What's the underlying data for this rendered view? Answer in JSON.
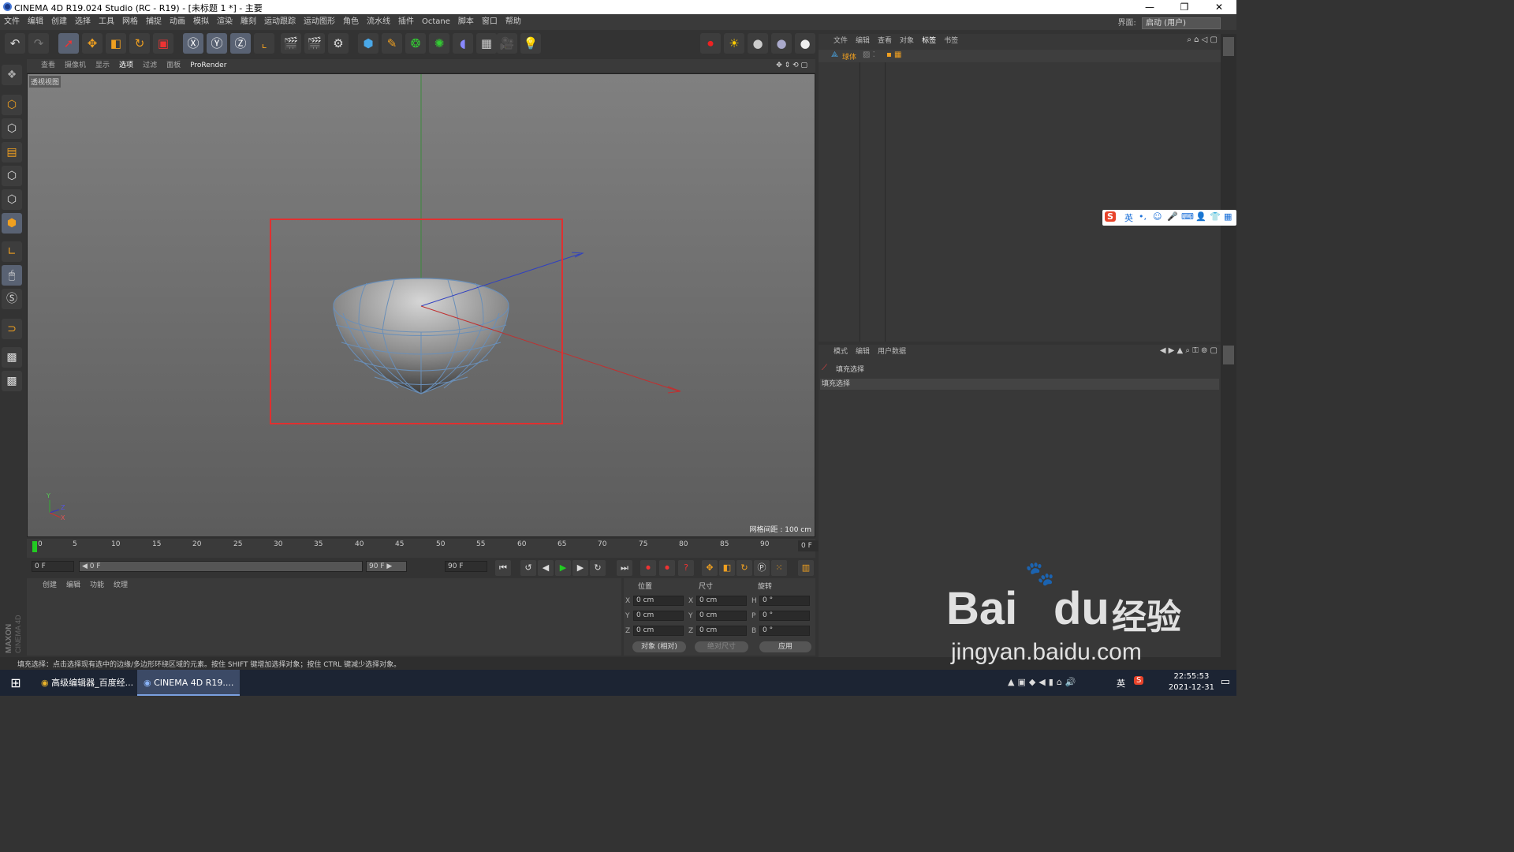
{
  "window": {
    "title": "CINEMA 4D R19.024 Studio (RC - R19) - [未标题 1 *] - 主要",
    "minimize": "—",
    "maximize": "❐",
    "close": "✕"
  },
  "menubar": {
    "items": [
      "文件",
      "编辑",
      "创建",
      "选择",
      "工具",
      "网格",
      "捕捉",
      "动画",
      "模拟",
      "渲染",
      "雕刻",
      "运动跟踪",
      "运动图形",
      "角色",
      "流水线",
      "插件",
      "Octane",
      "脚本",
      "窗口",
      "帮助"
    ],
    "interface_label": "界面:",
    "interface_value": "启动 (用户)"
  },
  "viewport": {
    "menu": [
      "查看",
      "摄像机",
      "显示",
      "选项",
      "过滤",
      "面板",
      "ProRender"
    ],
    "label": "透视视图",
    "grid_info": "网格间距 : 100 cm",
    "axis_y": "Y",
    "axis_z": "Z",
    "axis_x": "X"
  },
  "timeline": {
    "ticks": [
      "0",
      "5",
      "10",
      "15",
      "20",
      "25",
      "30",
      "35",
      "40",
      "45",
      "50",
      "55",
      "60",
      "65",
      "70",
      "75",
      "80",
      "85",
      "90"
    ],
    "current_frame": "0 F",
    "start_field": "0 F",
    "range_start": "◀ 0 F",
    "range_end": "90 F ▶",
    "end_field": "90 F"
  },
  "material_panel": {
    "menu": [
      "创建",
      "编辑",
      "功能",
      "纹理"
    ]
  },
  "coord_panel": {
    "headers": [
      "位置",
      "尺寸",
      "旋转"
    ],
    "rows": [
      {
        "axis": "X",
        "pos": "0 cm",
        "size_axis": "X",
        "size": "0 cm",
        "rot_axis": "H",
        "rot": "0 °"
      },
      {
        "axis": "Y",
        "pos": "0 cm",
        "size_axis": "Y",
        "size": "0 cm",
        "rot_axis": "P",
        "rot": "0 °"
      },
      {
        "axis": "Z",
        "pos": "0 cm",
        "size_axis": "Z",
        "size": "0 cm",
        "rot_axis": "B",
        "rot": "0 °"
      }
    ],
    "mode_select": "对象 (相对)",
    "size_select": "绝对尺寸",
    "apply": "应用"
  },
  "object_panel": {
    "menu": [
      "文件",
      "编辑",
      "查看",
      "对象",
      "标签",
      "书签"
    ],
    "object_name": "球体"
  },
  "attribute_panel": {
    "menu": [
      "模式",
      "编辑",
      "用户数据"
    ],
    "tool_name": "填充选择",
    "section": "填充选择"
  },
  "status": {
    "text": "填充选择：点击选择现有选中的边缘/多边形环绕区域的元素。按住 SHIFT 键增加选择对象；按住 CTRL 键减少选择对象。"
  },
  "maxon": {
    "line1": "MAXON",
    "line2": "CINEMA 4D"
  },
  "ime": {
    "brand": "S",
    "lang": "英"
  },
  "taskbar": {
    "items": [
      "高级编辑器_百度经...",
      "CINEMA 4D R19...."
    ],
    "tray_lang": "英",
    "time": "22:55:53",
    "date": "2021-12-31"
  },
  "watermark": {
    "brand": "Bai",
    "brand2": "du",
    "cn": "经验",
    "url": "jingyan.baidu.com"
  },
  "colors": {
    "selection_box": "#e03030",
    "active_tool": "#596273",
    "mesh": "#6a8fb8"
  }
}
